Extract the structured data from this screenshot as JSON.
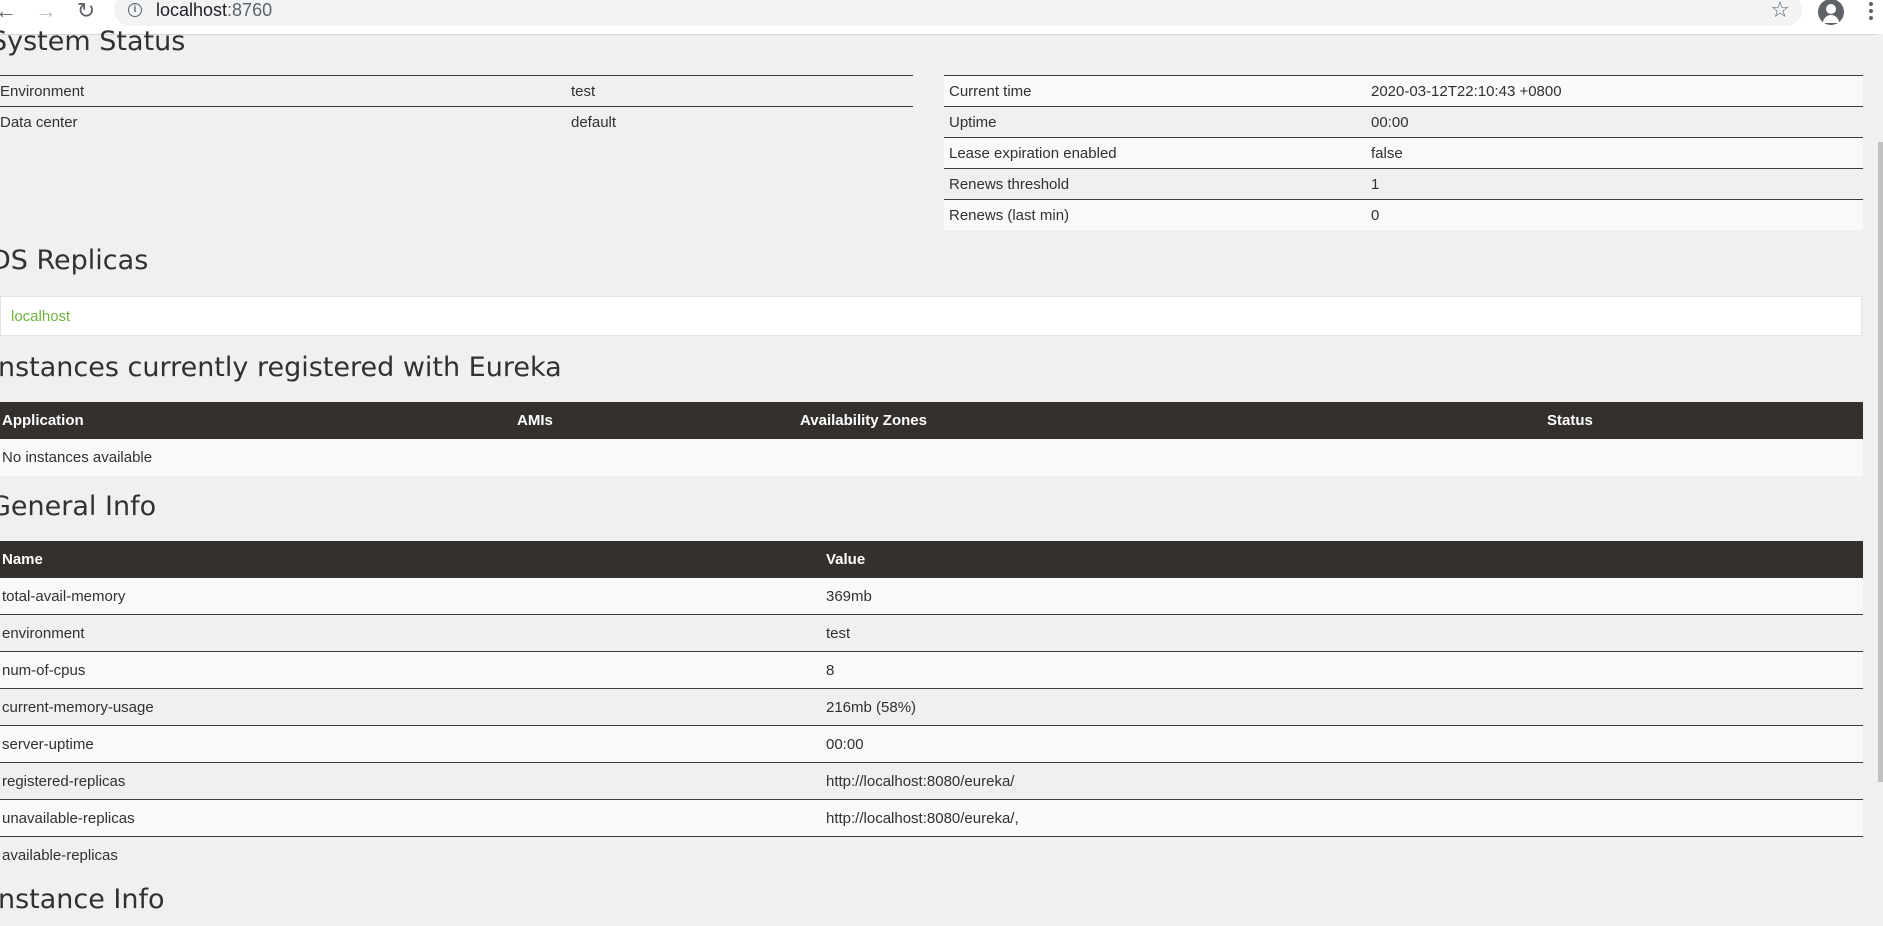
{
  "browser": {
    "back_icon": "←",
    "forward_icon": "→",
    "reload_icon": "↻",
    "url_host": "localhost",
    "url_port": ":8760",
    "info_icon": "i",
    "star_icon": "☆"
  },
  "system_status": {
    "title": "System Status",
    "left": [
      {
        "label": "Environment",
        "value": "test"
      },
      {
        "label": "Data center",
        "value": "default"
      }
    ],
    "right": [
      {
        "label": "Current time",
        "value": "2020-03-12T22:10:43 +0800"
      },
      {
        "label": "Uptime",
        "value": "00:00"
      },
      {
        "label": "Lease expiration enabled",
        "value": "false"
      },
      {
        "label": "Renews threshold",
        "value": "1"
      },
      {
        "label": "Renews (last min)",
        "value": "0"
      }
    ]
  },
  "ds_replicas": {
    "title": "DS Replicas",
    "items": [
      "localhost"
    ]
  },
  "instances": {
    "title": "Instances currently registered with Eureka",
    "headers": [
      "Application",
      "AMIs",
      "Availability Zones",
      "Status"
    ],
    "empty_text": "No instances available"
  },
  "general_info": {
    "title": "General Info",
    "headers": [
      "Name",
      "Value"
    ],
    "rows": [
      {
        "name": "total-avail-memory",
        "value": "369mb"
      },
      {
        "name": "environment",
        "value": "test"
      },
      {
        "name": "num-of-cpus",
        "value": "8"
      },
      {
        "name": "current-memory-usage",
        "value": "216mb (58%)"
      },
      {
        "name": "server-uptime",
        "value": "00:00"
      },
      {
        "name": "registered-replicas",
        "value": "http://localhost:8080/eureka/"
      },
      {
        "name": "unavailable-replicas",
        "value": "http://localhost:8080/eureka/,"
      },
      {
        "name": "available-replicas",
        "value": ""
      }
    ]
  },
  "instance_info": {
    "title": "Instance Info"
  },
  "colors": {
    "header_dark": "#34302d",
    "link_green": "#6db33f",
    "page_bg": "#f0f0f0"
  }
}
